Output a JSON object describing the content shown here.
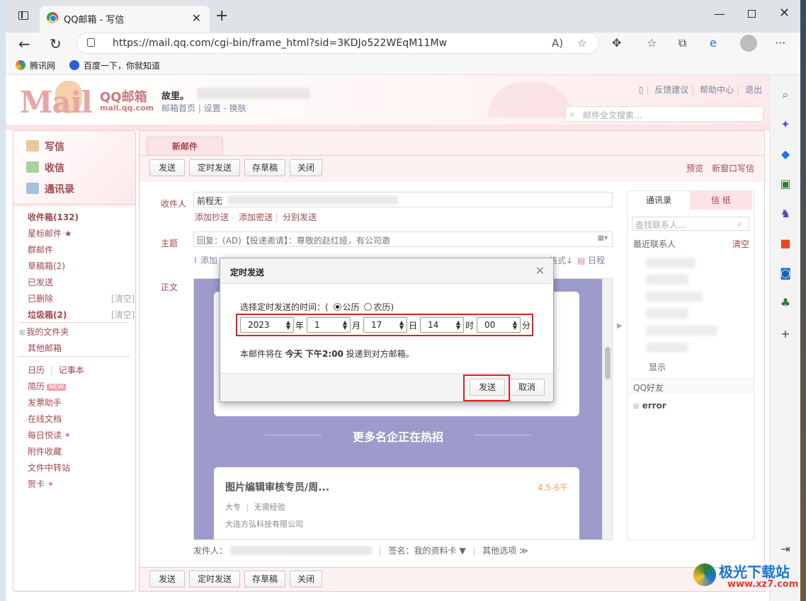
{
  "browser": {
    "tab_title": "QQ邮箱 - 写信",
    "url": "https://mail.qq.com/cgi-bin/frame_html?sid=3KDJo522WEqM11Mw",
    "bookmarks": [
      "腾讯网",
      "百度一下，你就知道"
    ]
  },
  "header": {
    "logo_text": "Mail",
    "logo_qq": "QQ邮箱",
    "logo_url": "mail.qq.com",
    "user_name": "故里。",
    "user_links": [
      "邮箱首页",
      "设置",
      "换肤"
    ],
    "top_links": [
      "反馈建议",
      "帮助中心",
      "退出"
    ],
    "search_placeholder": "邮件全文搜索..."
  },
  "leftnav": {
    "primary": [
      "写信",
      "收信",
      "通讯录"
    ],
    "folders": [
      {
        "label": "收件箱(132)",
        "bold": true
      },
      {
        "label": "星标邮件 ★"
      },
      {
        "label": "群邮件"
      },
      {
        "label": "草稿箱(2)"
      },
      {
        "label": "已发送"
      },
      {
        "label": "已删除",
        "clear": "[清空]"
      },
      {
        "label": "垃圾箱(2)",
        "bold": true,
        "clear": "[清空]"
      }
    ],
    "my_folders": "我的文件夹",
    "other_mailboxes": "其他邮箱",
    "apps": [
      "日历",
      "记事本",
      "简历",
      "发票助手",
      "在线文档",
      "每日悦读",
      "附件收藏",
      "文件中转站",
      "贺卡"
    ],
    "new_badge": "NEW"
  },
  "compose": {
    "tab_label": "新邮件",
    "buttons": {
      "send": "发送",
      "scheduled": "定时发送",
      "save_draft": "存草稿",
      "close": "关闭"
    },
    "preview": "预览",
    "new_window": "新窗口写信",
    "to_label": "收件人",
    "to_value": "前程无",
    "field_links": [
      "添加抄送",
      "添加密送",
      "分别发送"
    ],
    "subject_label": "主题",
    "subject_value": "回复：(AD)【投递邀请】：尊敬的赵红娅，有公司邀",
    "attach_label": "添加",
    "format_label": "格式↓",
    "calendar_label": "日程",
    "body_label": "正文",
    "hot_title": "更多名企正在热招",
    "job": {
      "title": "图片编辑审核专员/周...",
      "salary": "4.5-6千",
      "tags": [
        "大专",
        "无需经验"
      ],
      "company": "大连方弘科技有限公司"
    },
    "sender_label": "发件人：",
    "signature": "签名：我的资料卡 ▼",
    "other_options": "其他选项 ≫"
  },
  "contacts": {
    "tabs": [
      "通讯录",
      "信 纸"
    ],
    "search_placeholder": "查找联系人...",
    "recent_label": "最近联系人",
    "clear_label": "清空",
    "show_label": "显示",
    "qq_friends": "QQ好友",
    "error_group": "error"
  },
  "modal": {
    "title": "定时发送",
    "prompt": "选择定时发送的时间：(",
    "gregorian": "公历",
    "lunar": "农历)",
    "year": "2023",
    "year_unit": "年",
    "month": "1",
    "month_unit": "月",
    "day": "17",
    "day_unit": "日",
    "hour": "14",
    "hour_unit": "时",
    "minute": "00",
    "minute_unit": "分",
    "note_pre": "本邮件将在 ",
    "note_time": "今天 下午2:00",
    "note_post": " 投递到对方邮箱。",
    "send": "发送",
    "cancel": "取消"
  },
  "watermark": {
    "title": "极光下载站",
    "url": "www.xz7.com"
  }
}
